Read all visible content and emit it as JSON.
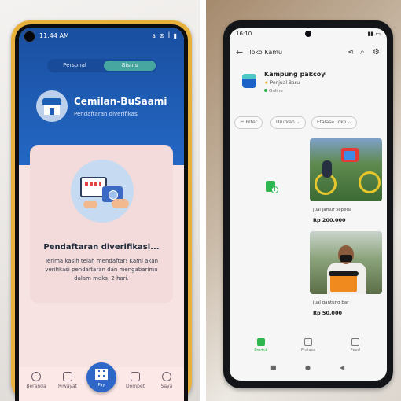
{
  "left_phone": {
    "status_time": "11.44 AM",
    "status_icons": "◉ ◷",
    "status_right": "ʙ ⊛ ꟾ ▮",
    "tabs": [
      "Personal",
      "Bisnis"
    ],
    "store_name": "Cemilan-BuSaami",
    "store_status": "Pendaftaran diverifikasi",
    "card_title": "Pendaftaran diverifikasi...",
    "card_message": "Terima kasih telah mendaftar! Kami akan verifikasi pendaftaran dan mengabarimu dalam maks. 2 hari.",
    "nav": [
      "Beranda",
      "Riwayat",
      "Pay",
      "Dompet",
      "Saya"
    ],
    "colors": {
      "header": "#2367c4",
      "frame": "#e7b13c"
    }
  },
  "right_phone": {
    "status_time": "16:10",
    "status_right": "▮▮ ▭",
    "header_title": "Toko Kamu",
    "header_icons": [
      "share-icon",
      "search-icon",
      "settings-icon"
    ],
    "shop_name": "Kampung pakcoy",
    "seller_badge": "Penjual Baru",
    "online_label": "Online",
    "filters": [
      "Filter",
      "Urutkan",
      "Etalase Toko"
    ],
    "products": [
      {
        "name": "jual jamur sepeda",
        "price": "Rp 200.000"
      },
      {
        "name": "jual gantung bar",
        "price": "Rp 50.000"
      }
    ],
    "nav": [
      "Produk",
      "Etalase",
      "Feed"
    ],
    "colors": {
      "accent": "#2fb64f"
    }
  }
}
